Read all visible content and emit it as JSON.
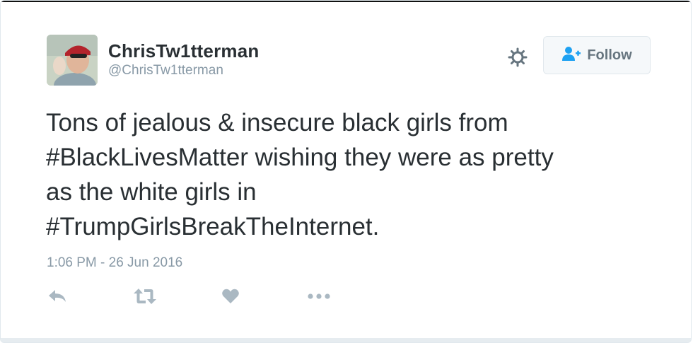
{
  "user": {
    "name": "ChrisTw1tterman",
    "handle": "@ChrisTw1tterman"
  },
  "follow_button": {
    "label": "Follow"
  },
  "tweet": {
    "line1": "Tons of jealous & insecure black girls from",
    "hashtag1": "#BlackLivesMatter",
    "line2_rest": " wishing they were as pretty",
    "line3": "as the white girls in",
    "hashtag2": "#TrumpGirlsBreakTheInternet",
    "ending": ".",
    "timestamp": "1:06 PM - 26 Jun 2016"
  },
  "icons": {
    "settings": "gear-icon",
    "follow": "person-add-icon",
    "reply": "reply-icon",
    "retweet": "retweet-icon",
    "like": "heart-icon",
    "more": "more-dots-icon"
  },
  "colors": {
    "text": "#292f33",
    "muted": "#8899a6",
    "icon": "#aab8c2",
    "follow_icon": "#1da1f2"
  }
}
